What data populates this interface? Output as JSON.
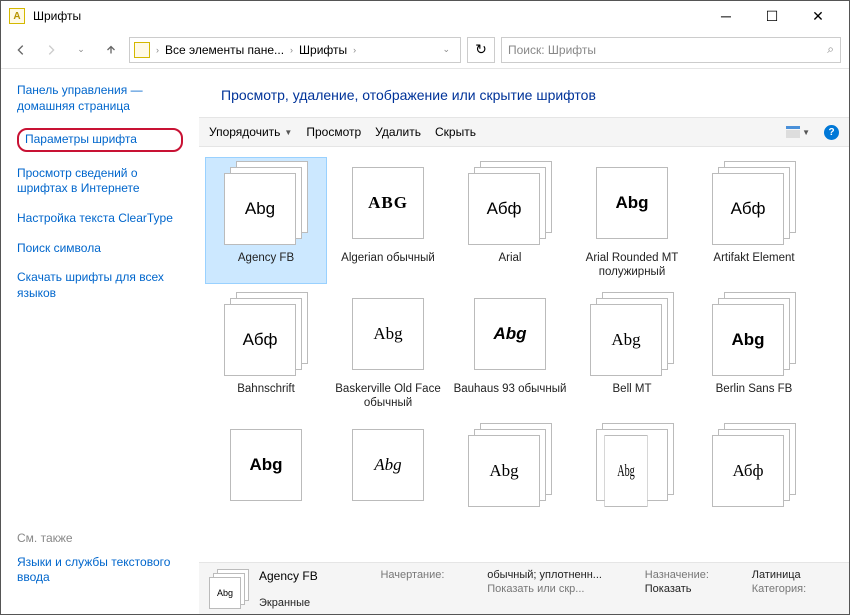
{
  "window": {
    "title": "Шрифты"
  },
  "breadcrumb": {
    "root": "Все элементы пане...",
    "current": "Шрифты"
  },
  "search": {
    "placeholder": "Поиск: Шрифты"
  },
  "sidebar": {
    "home": "Панель управления — домашняя страница",
    "params": "Параметры шрифта",
    "internet": "Просмотр сведений о шрифтах в Интернете",
    "cleartype": "Настройка текста ClearType",
    "findchar": "Поиск символа",
    "download": "Скачать шрифты для всех языков",
    "see_also_label": "См. также",
    "text_services": "Языки и службы текстового ввода"
  },
  "main": {
    "title": "Просмотр, удаление, отображение или скрытие шрифтов"
  },
  "toolbar": {
    "arrange": "Упорядочить",
    "view": "Просмотр",
    "delete": "Удалить",
    "hide": "Скрыть"
  },
  "fonts": [
    {
      "sample": "Abg",
      "name": "Agency FB",
      "stack": true,
      "style": "font-family:Arial;font-weight:normal;"
    },
    {
      "sample": "ABG",
      "name": "Algerian обычный",
      "stack": false,
      "style": "font-family:serif;letter-spacing:1px;font-weight:bold;"
    },
    {
      "sample": "Абф",
      "name": "Arial",
      "stack": true,
      "style": "font-family:Arial;"
    },
    {
      "sample": "Abg",
      "name": "Arial Rounded MT полужирный",
      "stack": false,
      "style": "font-family:Arial;font-weight:bold;"
    },
    {
      "sample": "Абф",
      "name": "Artifakt Element",
      "stack": true,
      "style": "font-family:Arial;"
    },
    {
      "sample": "Абф",
      "name": "Bahnschrift",
      "stack": true,
      "style": "font-family:Arial;"
    },
    {
      "sample": "Abg",
      "name": "Baskerville Old Face обычный",
      "stack": false,
      "style": "font-family:Georgia,serif;"
    },
    {
      "sample": "Abg",
      "name": "Bauhaus 93 обычный",
      "stack": false,
      "style": "font-family:Arial;font-weight:900;font-style:italic;"
    },
    {
      "sample": "Abg",
      "name": "Bell MT",
      "stack": true,
      "style": "font-family:Georgia,serif;"
    },
    {
      "sample": "Abg",
      "name": "Berlin Sans FB",
      "stack": true,
      "style": "font-family:Arial;font-weight:bold;"
    },
    {
      "sample": "Abg",
      "name": "",
      "stack": false,
      "style": "font-family:Arial;font-weight:900;"
    },
    {
      "sample": "Abg",
      "name": "",
      "stack": false,
      "style": "font-family:cursive;font-style:italic;"
    },
    {
      "sample": "Abg",
      "name": "",
      "stack": true,
      "style": "font-family:Georgia,serif;"
    },
    {
      "sample": "Abg",
      "name": "",
      "stack": true,
      "style": "font-family:serif;transform:scaleX(0.6);"
    },
    {
      "sample": "Абф",
      "name": "",
      "stack": true,
      "style": "font-family:Georgia,serif;"
    }
  ],
  "details": {
    "title": "Agency FB",
    "style_label": "Начертание:",
    "style_value": "обычный; уплотненн...",
    "show_label": "Показать или скр...",
    "show_value": "Показать",
    "charset_label": "Назначение:",
    "charset_value": "Латиница",
    "category_label": "Категория:",
    "category_value": "Экранные",
    "sample": "Abg"
  }
}
